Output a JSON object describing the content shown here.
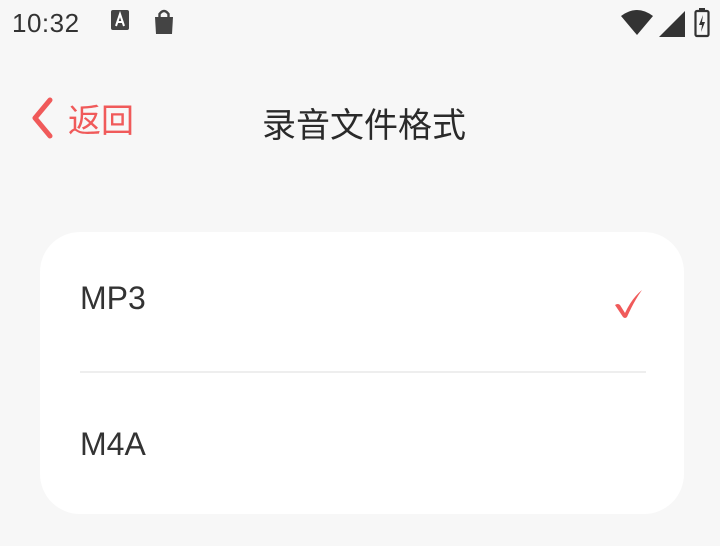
{
  "status_bar": {
    "time": "10:32",
    "left_icons": [
      "a-letter-icon",
      "shopping-bag-icon"
    ],
    "right_icons": [
      "wifi-icon",
      "signal-icon",
      "battery-icon"
    ]
  },
  "header": {
    "back_label": "返回",
    "title": "录音文件格式"
  },
  "options": [
    {
      "label": "MP3",
      "selected": true
    },
    {
      "label": "M4A",
      "selected": false
    }
  ],
  "colors": {
    "accent": "#f05a5a",
    "background": "#f7f7f7",
    "card": "#ffffff",
    "text": "#333333"
  }
}
